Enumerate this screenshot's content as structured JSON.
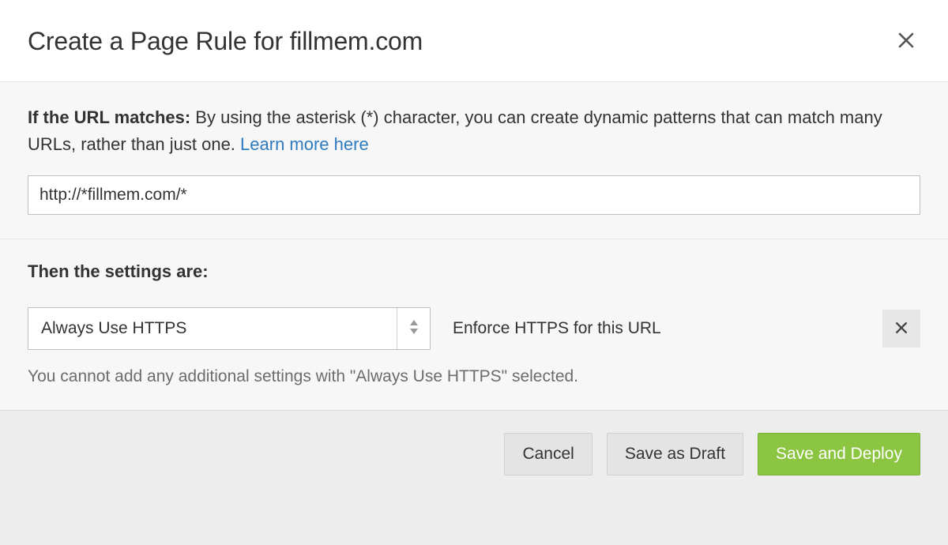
{
  "header": {
    "title": "Create a Page Rule for fillmem.com"
  },
  "url_section": {
    "lead_bold": "If the URL matches:",
    "lead_rest": " By using the asterisk (*) character, you can create dynamic patterns that can match many URLs, rather than just one. ",
    "learn_more": "Learn more here",
    "input_value": "http://*fillmem.com/*"
  },
  "settings_section": {
    "heading": "Then the settings are:",
    "select_value": "Always Use HTTPS",
    "description": "Enforce HTTPS for this URL",
    "note": "You cannot add any additional settings with \"Always Use HTTPS\" selected."
  },
  "footer": {
    "cancel": "Cancel",
    "draft": "Save as Draft",
    "deploy": "Save and Deploy"
  }
}
